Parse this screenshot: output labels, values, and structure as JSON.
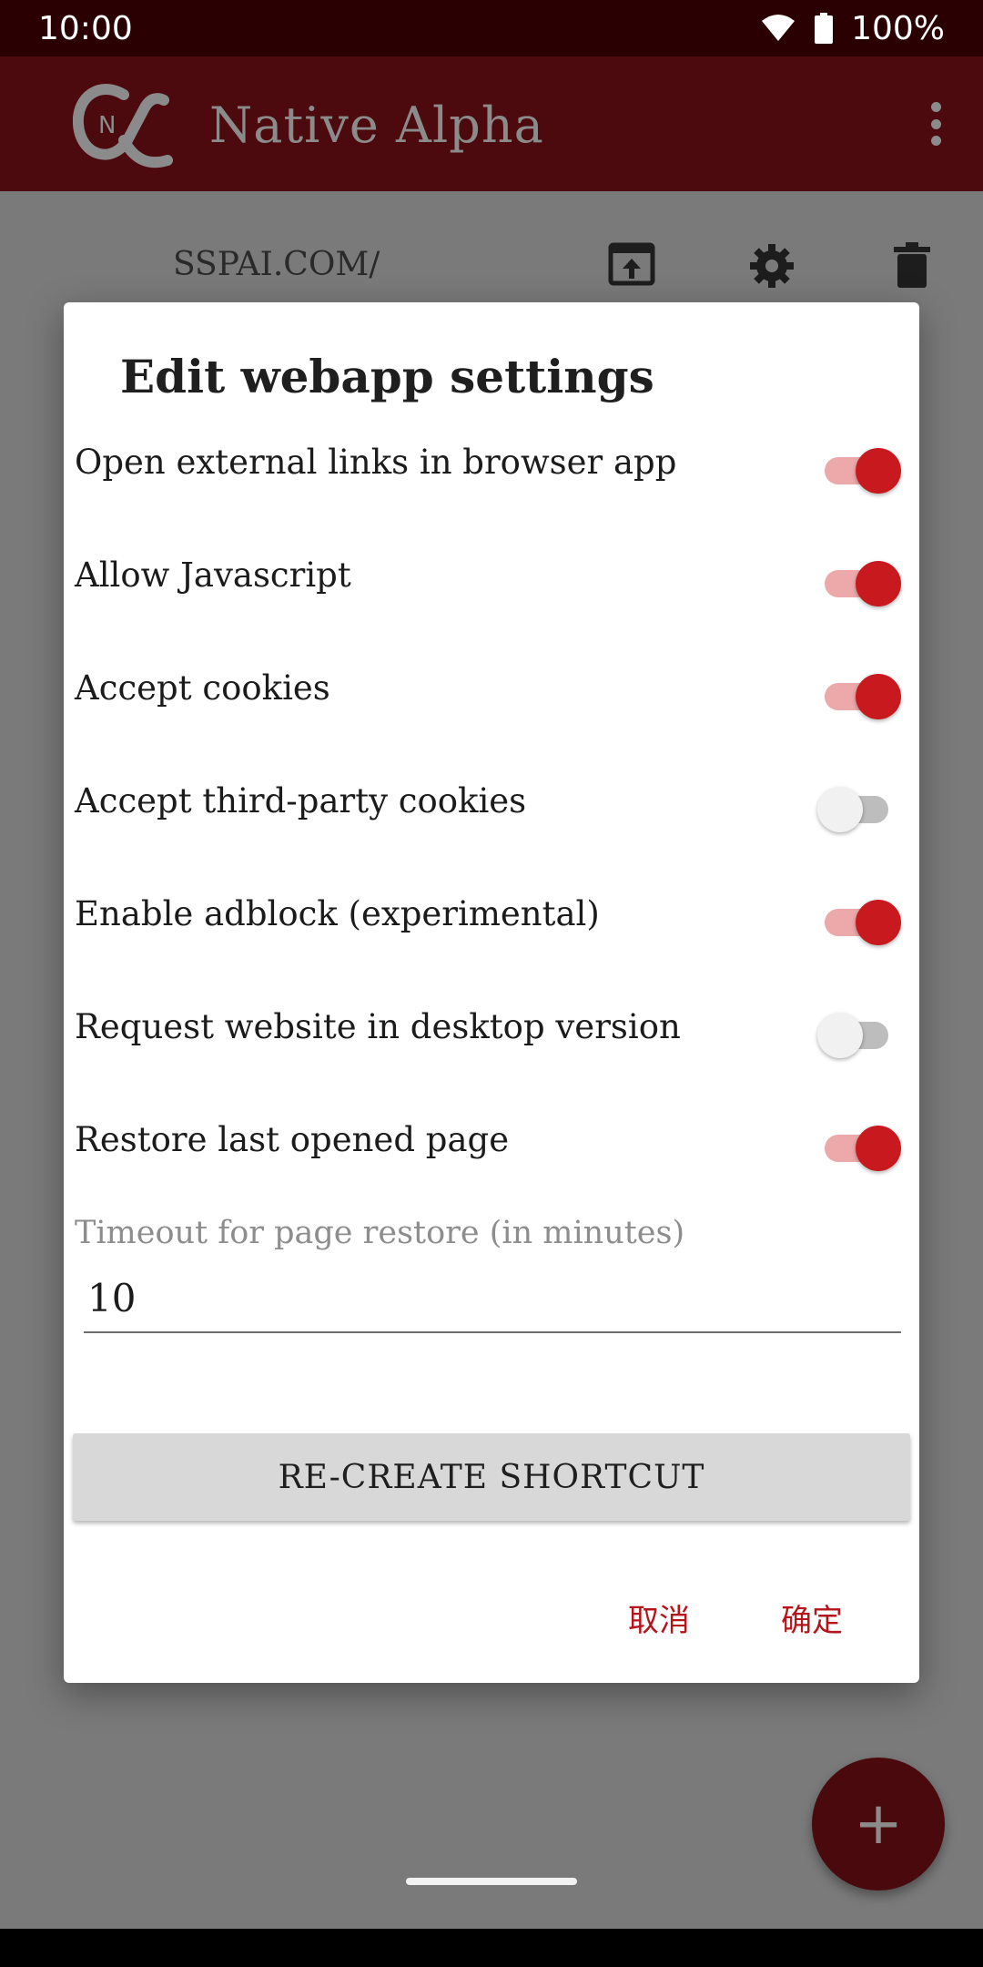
{
  "status_bar": {
    "time": "10:00",
    "battery": "100%",
    "icons": [
      "wifi-icon",
      "battery-icon"
    ]
  },
  "app_bar": {
    "title": "Native Alpha",
    "logo_letter": "N",
    "icons": [
      "alpha-logo-icon",
      "overflow-menu-icon"
    ]
  },
  "background": {
    "webapp_url": "SSPAI.COM/",
    "icons": [
      "open-in-app-icon",
      "settings-gear-icon",
      "delete-trash-icon"
    ]
  },
  "dialog": {
    "title": "Edit webapp settings",
    "settings": [
      {
        "label": "Open external links in browser app",
        "on": true
      },
      {
        "label": "Allow Javascript",
        "on": true
      },
      {
        "label": "Accept cookies",
        "on": true
      },
      {
        "label": "Accept third-party cookies",
        "on": false
      },
      {
        "label": "Enable adblock (experimental)",
        "on": true
      },
      {
        "label": "Request website in desktop version",
        "on": false
      },
      {
        "label": "Restore last opened page",
        "on": true
      }
    ],
    "timeout_label": "Timeout for page restore (in minutes)",
    "timeout_value": "10",
    "recreate_label": "RE-CREATE SHORTCUT",
    "cancel_label": "取消",
    "confirm_label": "确定"
  },
  "fab": {
    "label": "+"
  },
  "colors": {
    "accent": "#c8191f",
    "app_bar": "#4c0a0e",
    "status_bar": "#2b0002"
  }
}
